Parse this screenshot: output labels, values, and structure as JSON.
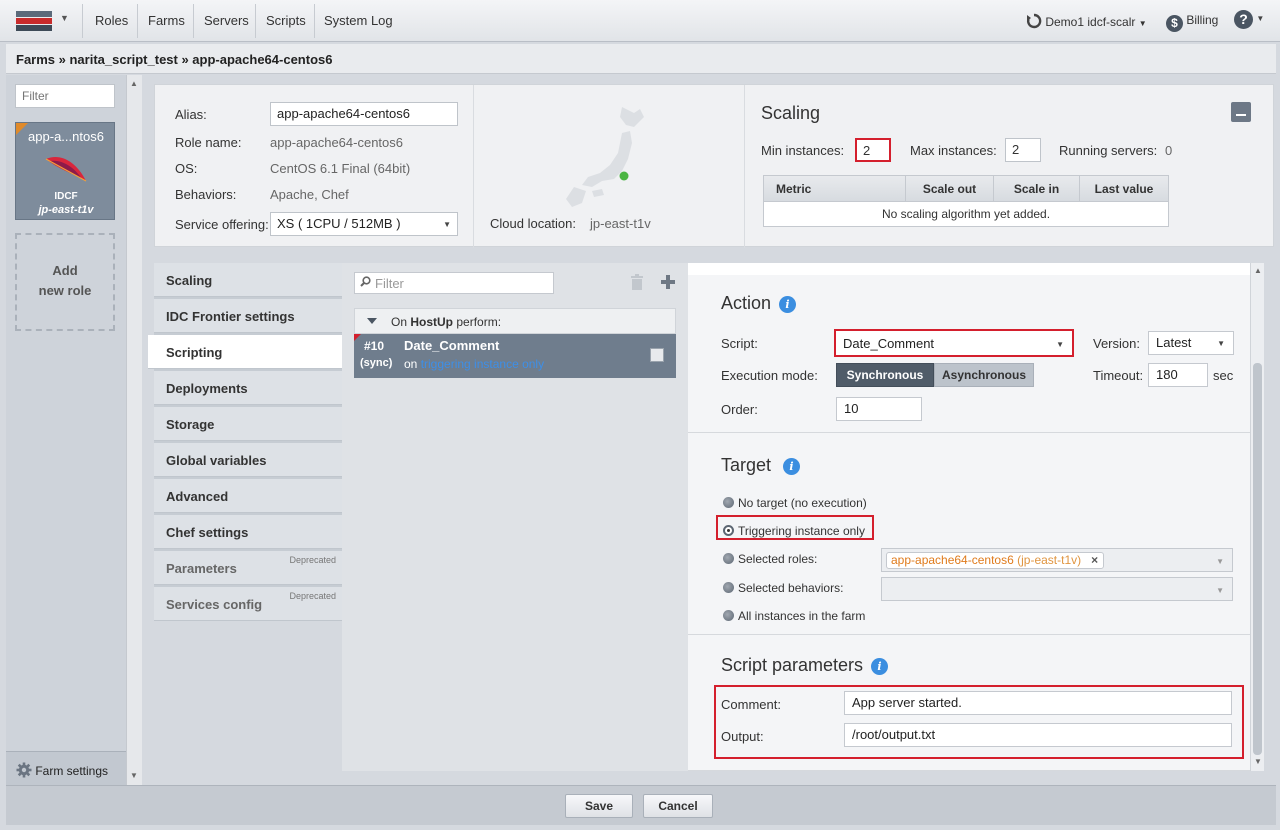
{
  "topbar": {
    "menu": [
      "Roles",
      "Farms",
      "Servers",
      "Scripts",
      "System Log"
    ],
    "user": "Demo1 idcf-scalr",
    "billing": "Billing",
    "help": "?"
  },
  "breadcrumb": "Farms » narita_script_test » app-apache64-centos6",
  "left": {
    "filter_placeholder": "Filter",
    "role_card": {
      "name": "app-a...ntos6",
      "cloud": "IDCF",
      "location": "jp-east-t1v"
    },
    "add_role": [
      "Add",
      "new role"
    ],
    "farm_settings": "Farm settings"
  },
  "info": {
    "alias_label": "Alias:",
    "alias_value": "app-apache64-centos6",
    "role_name_label": "Role name:",
    "role_name_value": "app-apache64-centos6",
    "os_label": "OS:",
    "os_value": "CentOS 6.1 Final (64bit)",
    "behaviors_label": "Behaviors:",
    "behaviors_value": "Apache, Chef",
    "service_label": "Service offering:",
    "service_value": "XS ( 1CPU / 512MB )",
    "cloud_location_label": "Cloud location:",
    "cloud_location_value": "jp-east-t1v"
  },
  "scaling": {
    "title": "Scaling",
    "min_label": "Min instances:",
    "min_value": "2",
    "max_label": "Max instances:",
    "max_value": "2",
    "running_label": "Running servers:",
    "running_value": "0",
    "columns": [
      "Metric",
      "Scale out",
      "Scale in",
      "Last value"
    ],
    "empty_text": "No scaling algorithm yet added."
  },
  "tabs": [
    {
      "label": "Scaling"
    },
    {
      "label": "IDC Frontier settings"
    },
    {
      "label": "Scripting",
      "active": true
    },
    {
      "label": "Deployments"
    },
    {
      "label": "Storage"
    },
    {
      "label": "Global variables"
    },
    {
      "label": "Advanced"
    },
    {
      "label": "Chef settings"
    },
    {
      "label": "Parameters",
      "badge": "Deprecated"
    },
    {
      "label": "Services config",
      "badge": "Deprecated"
    }
  ],
  "scripts": {
    "filter_placeholder": "Filter",
    "group_prefix": "On ",
    "group_event": "HostUp",
    "group_suffix": " perform:",
    "item": {
      "number": "#10",
      "mode": "(sync)",
      "name": "Date_Comment",
      "on_text": "on ",
      "on_link": "triggering instance only"
    }
  },
  "action": {
    "title": "Action",
    "script_label": "Script:",
    "script_value": "Date_Comment",
    "version_label": "Version:",
    "version_value": "Latest",
    "exec_label": "Execution mode:",
    "sync_label": "Synchronous",
    "async_label": "Asynchronous",
    "timeout_label": "Timeout:",
    "timeout_value": "180",
    "timeout_unit": "sec",
    "order_label": "Order:",
    "order_value": "10"
  },
  "target": {
    "title": "Target",
    "options": [
      "No target (no execution)",
      "Triggering instance only",
      "Selected roles:",
      "Selected behaviors:",
      "All instances in the farm"
    ],
    "selected_index": 1,
    "role_chip": "app-apache64-centos6",
    "role_chip_loc": "(jp-east-t1v)"
  },
  "params": {
    "title": "Script parameters",
    "comment_label": "Comment:",
    "comment_value": "App server started.",
    "output_label": "Output:",
    "output_value": "/root/output.txt"
  },
  "bottom": {
    "save": "Save",
    "cancel": "Cancel"
  }
}
